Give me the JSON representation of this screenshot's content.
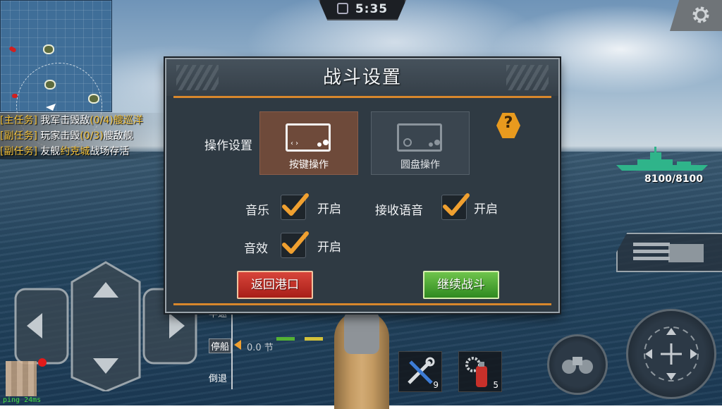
{
  "hud": {
    "timer": "5:35",
    "enemy_hp": "8100/8100",
    "ping": "ping 24ms"
  },
  "missions": [
    {
      "tag": "[主任务]",
      "pre": "我军击毁敌",
      "progress": "(0/4)",
      "post": "艘巡洋"
    },
    {
      "tag": "[副任务]",
      "pre": "玩家击毁",
      "progress": "(0/3)",
      "post": "艘敌舰"
    },
    {
      "tag": "[副任务]",
      "pre": "友舰",
      "progress": "约克城",
      "post": "战场存活"
    }
  ],
  "throttle": {
    "half_ahead": "半速",
    "stop": "停船",
    "reverse": "倒退",
    "speed": "0.0 节"
  },
  "tools": [
    {
      "icon": "repair-tools-icon",
      "count": "9"
    },
    {
      "icon": "fire-extinguisher-icon",
      "count": "5"
    }
  ],
  "dialog": {
    "title": "战斗设置",
    "control_label": "操作设置",
    "modes": [
      {
        "label": "按键操作",
        "selected": true
      },
      {
        "label": "圆盘操作",
        "selected": false
      }
    ],
    "help": "?",
    "settings": [
      {
        "label": "音乐",
        "value": "开启",
        "checked": true
      },
      {
        "label": "接收语音",
        "value": "开启",
        "checked": true
      },
      {
        "label": "音效",
        "value": "开启",
        "checked": true
      }
    ],
    "back_button": "返回港口",
    "continue_button": "继续战斗"
  },
  "colors": {
    "accent_orange": "#d8872c",
    "back_red": "#c0302a",
    "continue_green": "#4fa836",
    "check_orange": "#f0a030",
    "selected_mode": "#6e4a3a"
  }
}
